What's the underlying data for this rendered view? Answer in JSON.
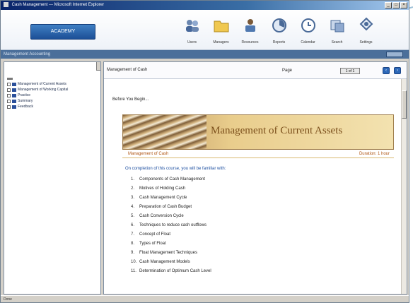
{
  "window": {
    "title": "Cash Management — Microsoft Internet Explorer",
    "controls": [
      "_",
      "□",
      "×"
    ]
  },
  "header": {
    "logo_text": "ACADEMY"
  },
  "toolbar": {
    "tools": [
      {
        "label": "Users",
        "icon": "users-icon"
      },
      {
        "label": "Managers",
        "icon": "folder-icon"
      },
      {
        "label": "Resources",
        "icon": "resources-icon"
      },
      {
        "label": "Reports",
        "icon": "reports-icon"
      },
      {
        "label": "Calendar",
        "icon": "calendar-icon"
      },
      {
        "label": "Search",
        "icon": "search-icon"
      },
      {
        "label": "Settings",
        "icon": "settings-icon"
      }
    ]
  },
  "nav_strip": {
    "text": "Management Accounting"
  },
  "sidebar": {
    "items": [
      {
        "label": "Management of Current Assets"
      },
      {
        "label": "Management of Working Capital"
      },
      {
        "label": "Practice"
      },
      {
        "label": "Summary"
      },
      {
        "label": "Feedback"
      }
    ]
  },
  "content": {
    "breadcrumb": "Management of Cash",
    "page_label": "Page",
    "page_select": "1 of 1",
    "before_text": "Before You Begin...",
    "banner_title": "Management of Current Assets",
    "sub_left": "Management of Cash",
    "sub_right": "Duration: 1 hour",
    "intro": "On completion of this course, you will be familiar with:",
    "topics": [
      {
        "num": "1.",
        "text": "Components of Cash Management"
      },
      {
        "num": "2.",
        "text": "Motives of Holding Cash"
      },
      {
        "num": "3.",
        "text": "Cash Management Cycle"
      },
      {
        "num": "4.",
        "text": "Preparation of Cash Budget"
      },
      {
        "num": "5.",
        "text": "Cash Conversion Cycle"
      },
      {
        "num": "6.",
        "text": "Techniques to reduce cash outflows"
      },
      {
        "num": "7.",
        "text": "Concept of Float"
      },
      {
        "num": "8.",
        "text": "Types of Float"
      },
      {
        "num": "9.",
        "text": "Float Management Techniques"
      },
      {
        "num": "10.",
        "text": "Cash Management Models"
      },
      {
        "num": "11.",
        "text": "Determination of Optimum Cash Level"
      }
    ]
  },
  "statusbar": {
    "text": "Done"
  },
  "colors": {
    "title_bar": "#0a246a",
    "accent_blue": "#2d68b8",
    "banner_text": "#7a4e1a",
    "sub_text": "#b05818",
    "intro_text": "#1d4fa0"
  }
}
